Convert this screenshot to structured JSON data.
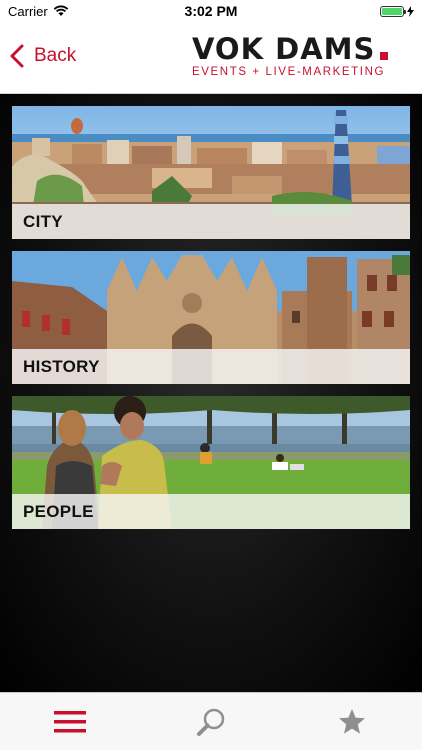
{
  "status_bar": {
    "carrier": "Carrier",
    "time": "3:02 PM",
    "battery_level": 1.0,
    "icons": [
      "wifi-icon",
      "battery-icon",
      "charging-icon"
    ]
  },
  "nav": {
    "back_label": "Back",
    "logo_main": "VOK DAMS",
    "logo_sub": "EVENTS + LIVE-MARKETING"
  },
  "tiles": [
    {
      "label": "CITY",
      "image": "barcelona-city-skyline-photo"
    },
    {
      "label": "HISTORY",
      "image": "gothic-cathedral-photo"
    },
    {
      "label": "PEOPLE",
      "image": "couple-in-park-photo"
    }
  ],
  "tab_bar": {
    "items": [
      {
        "icon": "menu-icon",
        "active": true
      },
      {
        "icon": "search-icon",
        "active": false
      },
      {
        "icon": "star-icon",
        "active": false
      }
    ]
  },
  "colors": {
    "accent": "#c8102e",
    "inactive_icon": "#8e8e93",
    "background": "#000000"
  }
}
